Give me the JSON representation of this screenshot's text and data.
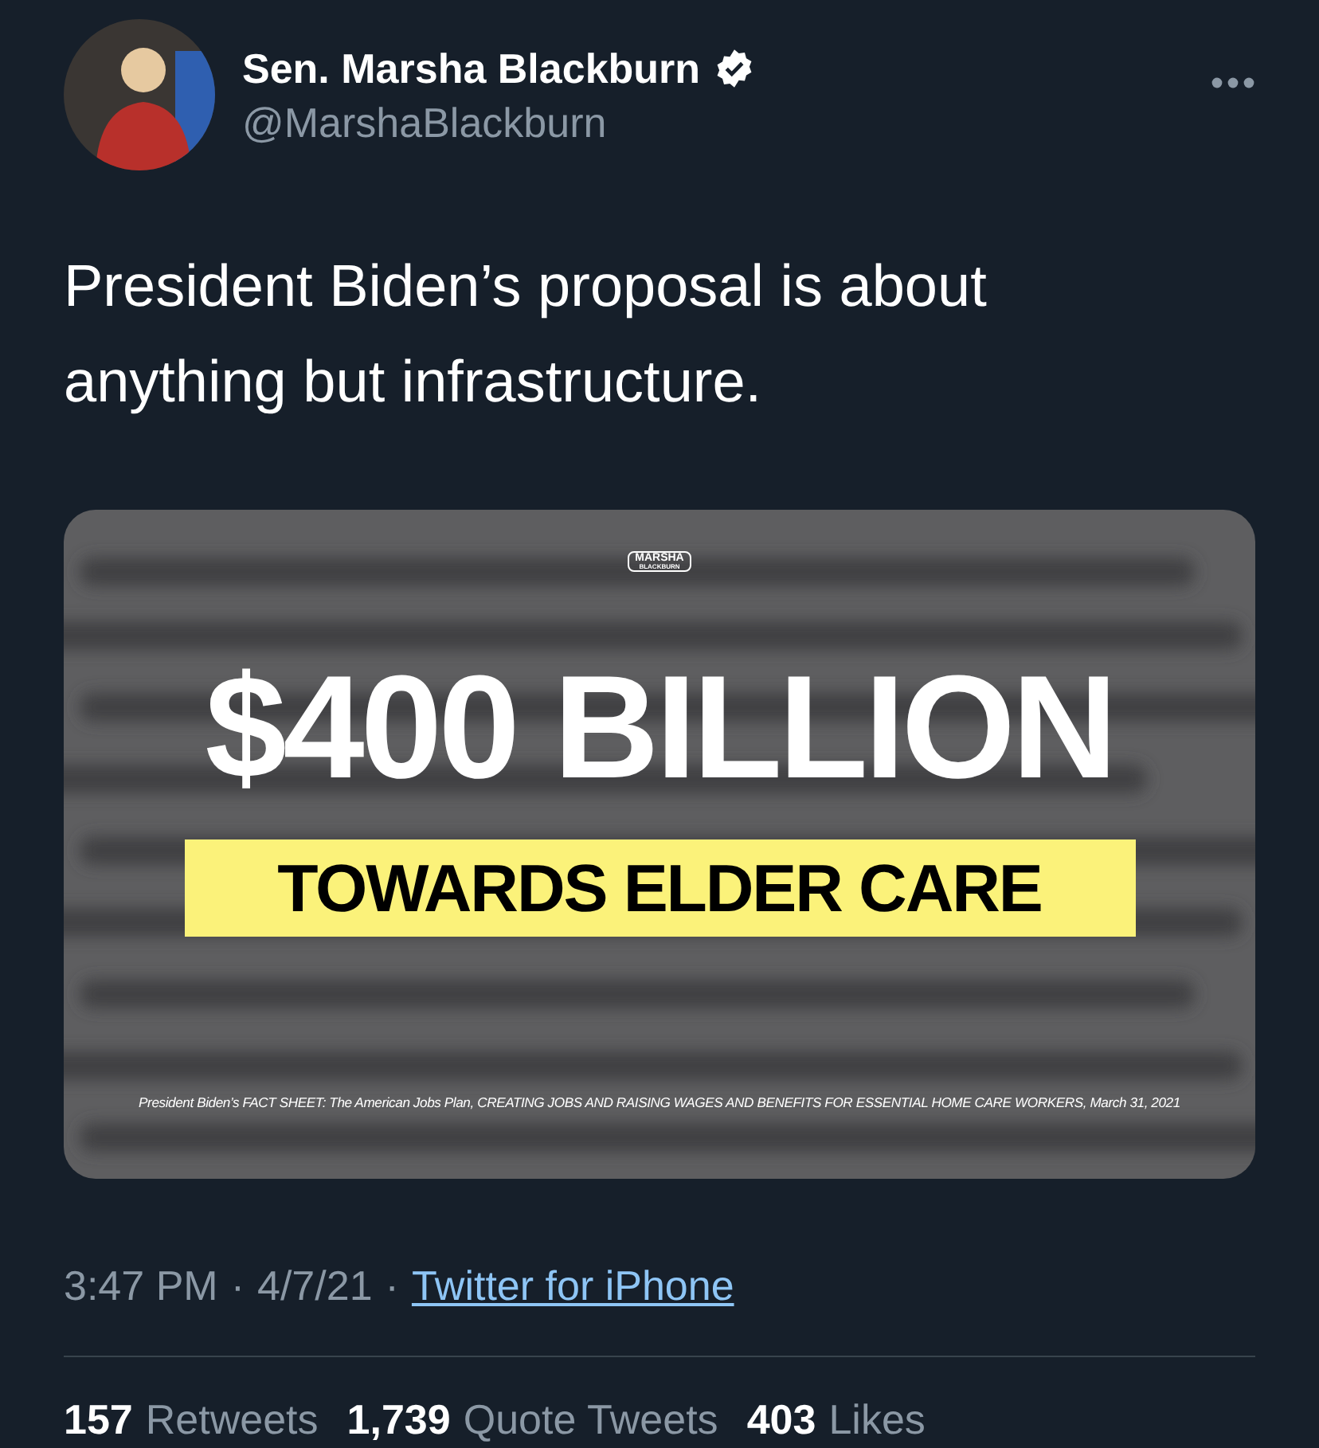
{
  "author": {
    "name": "Sen. Marsha Blackburn",
    "verified": true,
    "handle": "@MarshaBlackburn"
  },
  "text": "President Biden’s proposal is about anything but infrastructure.",
  "media": {
    "kind": "graphic",
    "logo": [
      "MARSHA",
      "BLACKBURN"
    ],
    "headline": "$400 BILLION",
    "banner": "TOWARDS ELDER CARE",
    "caption": "President Biden’s FACT SHEET: The American Jobs Plan, CREATING JOBS AND RAISING WAGES AND BENEFITS FOR ESSENTIAL HOME CARE WORKERS, March 31, 2021"
  },
  "meta": {
    "time": "3:47 PM",
    "separator_1": "·",
    "date": "4/7/21",
    "separator_2": "·",
    "source": "Twitter for iPhone"
  },
  "stats": [
    {
      "count": "157",
      "label": "Retweets"
    },
    {
      "count": "1,739",
      "label": "Quote Tweets"
    },
    {
      "count": "403",
      "label": "Likes"
    }
  ]
}
